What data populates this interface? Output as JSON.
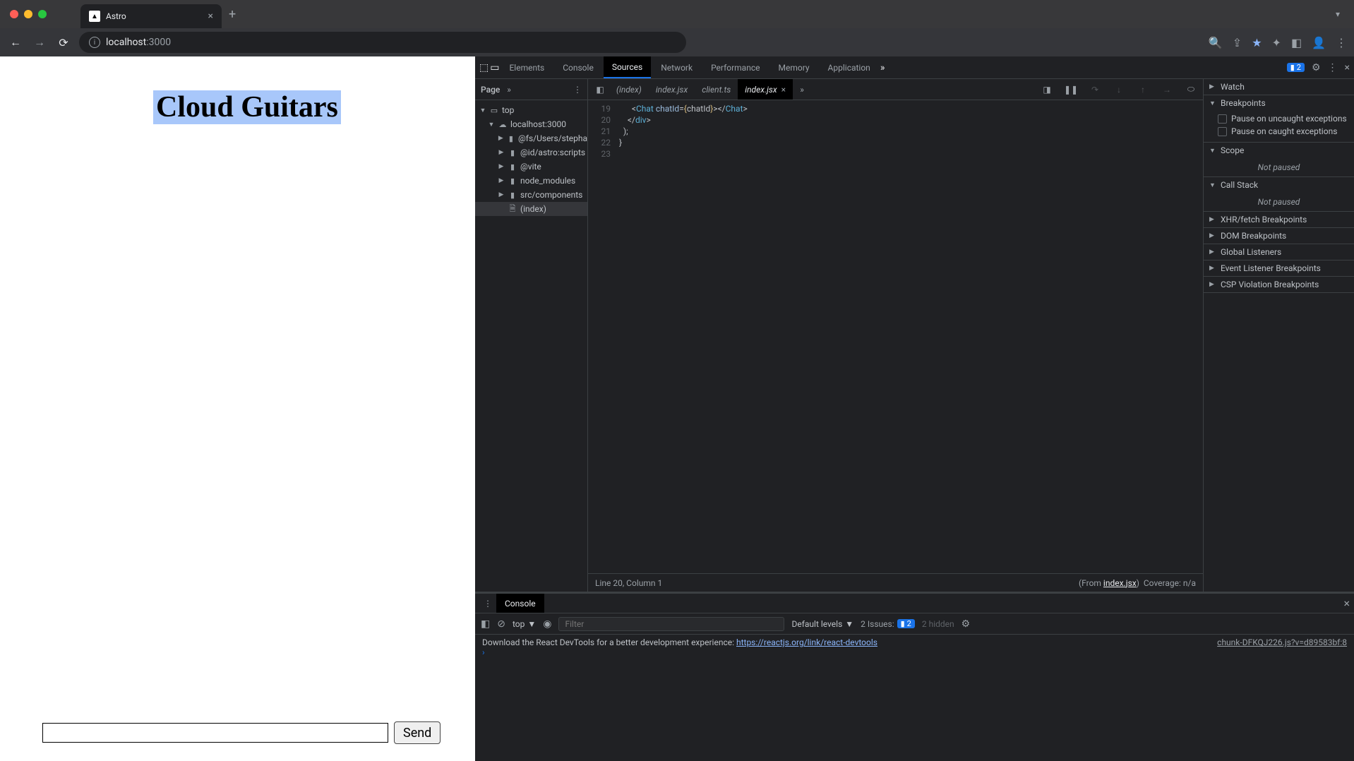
{
  "browser": {
    "tab_title": "Astro",
    "url_host": "localhost",
    "url_port": ":3000"
  },
  "page": {
    "title": "Cloud Guitars",
    "send_button": "Send"
  },
  "devtools": {
    "tabs": [
      "Elements",
      "Console",
      "Sources",
      "Network",
      "Performance",
      "Memory",
      "Application"
    ],
    "active_tab": "Sources",
    "issues_count": "2",
    "page_subtab": "Page",
    "file_tree": {
      "top": "top",
      "host": "localhost:3000",
      "items": [
        "@fs/Users/stepha",
        "@id/astro:scripts",
        "@vite",
        "node_modules",
        "src/components",
        "(index)"
      ]
    },
    "editor": {
      "tabs": [
        "(index)",
        "index.jsx",
        "client.ts",
        "index.jsx"
      ],
      "active_tab_index": 3,
      "line_numbers": [
        "19",
        "20",
        "21",
        "22",
        "23"
      ],
      "status_line": "Line 20, Column 1",
      "from_label": "(From ",
      "from_file": "index.jsx",
      "from_close": ")",
      "coverage": "Coverage: n/a"
    },
    "debug": {
      "sections": {
        "watch": "Watch",
        "breakpoints": "Breakpoints",
        "pause_uncaught": "Pause on uncaught exceptions",
        "pause_caught": "Pause on caught exceptions",
        "scope": "Scope",
        "not_paused": "Not paused",
        "call_stack": "Call Stack",
        "xhr": "XHR/fetch Breakpoints",
        "dom": "DOM Breakpoints",
        "global": "Global Listeners",
        "event": "Event Listener Breakpoints",
        "csp": "CSP Violation Breakpoints"
      }
    },
    "console": {
      "tab": "Console",
      "scope": "top",
      "filter_placeholder": "Filter",
      "levels": "Default levels",
      "issues_label": "2 Issues:",
      "issues_count": "2",
      "hidden": "2 hidden",
      "output_src": "chunk-DFKQJ226.js?v=d89583bf:8",
      "output_text": "Download the React DevTools for a better development experience: ",
      "output_link": "https://reactjs.org/link/react-devtools"
    }
  }
}
